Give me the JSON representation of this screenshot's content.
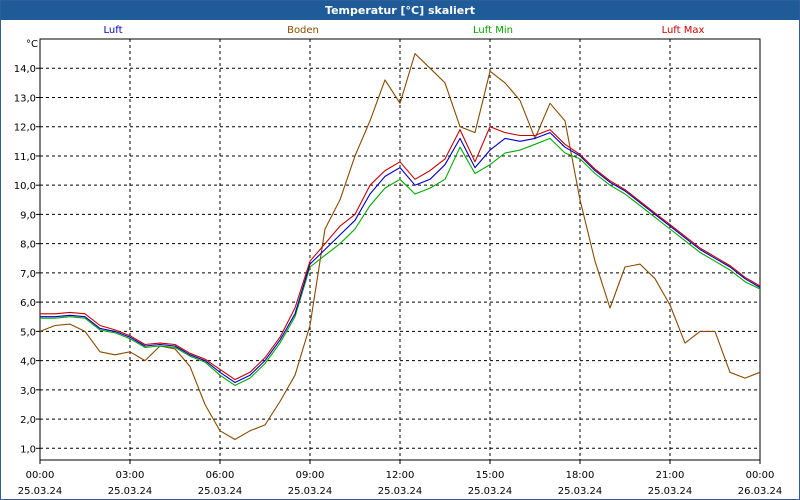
{
  "chart_data": {
    "type": "line",
    "title": "Temperatur [°C] skaliert",
    "ylabel": "°C",
    "ylim": [
      0.6,
      15.0
    ],
    "y_ticks": [
      "1,0",
      "2,0",
      "3,0",
      "4,0",
      "5,0",
      "6,0",
      "7,0",
      "8,0",
      "9,0",
      "10,0",
      "11,0",
      "12,0",
      "13,0",
      "14,0"
    ],
    "x_ticks": [
      {
        "time": "00:00",
        "date": "25.03.24"
      },
      {
        "time": "03:00",
        "date": "25.03.24"
      },
      {
        "time": "06:00",
        "date": "25.03.24"
      },
      {
        "time": "09:00",
        "date": "25.03.24"
      },
      {
        "time": "12:00",
        "date": "25.03.24"
      },
      {
        "time": "15:00",
        "date": "25.03.24"
      },
      {
        "time": "18:00",
        "date": "25.03.24"
      },
      {
        "time": "21:00",
        "date": "25.03.24"
      },
      {
        "time": "00:00",
        "date": "26.03.24"
      }
    ],
    "grid": true,
    "series": [
      {
        "name": "Luft",
        "color": "#0000c8",
        "x": [
          0,
          0.5,
          1,
          1.5,
          2,
          2.5,
          3,
          3.5,
          4,
          4.5,
          5,
          5.5,
          6,
          6.5,
          7,
          7.5,
          8,
          8.5,
          9,
          9.5,
          10,
          10.5,
          11,
          11.5,
          12,
          12.5,
          13,
          13.5,
          14,
          14.5,
          15,
          15.5,
          16,
          16.5,
          17,
          17.5,
          18,
          18.5,
          19,
          19.5,
          20,
          20.5,
          21,
          21.5,
          22,
          22.5,
          23,
          23.5,
          24
        ],
        "y": [
          5.5,
          5.5,
          5.55,
          5.5,
          5.1,
          5.0,
          4.8,
          4.5,
          4.55,
          4.5,
          4.2,
          4.0,
          3.6,
          3.25,
          3.5,
          4.0,
          4.7,
          5.6,
          7.3,
          7.8,
          8.3,
          8.8,
          9.7,
          10.3,
          10.6,
          10.0,
          10.2,
          10.7,
          11.6,
          10.6,
          11.2,
          11.6,
          11.5,
          11.6,
          11.8,
          11.3,
          11.0,
          10.5,
          10.1,
          9.8,
          9.4,
          9.0,
          8.6,
          8.2,
          7.8,
          7.5,
          7.2,
          6.8,
          6.5
        ]
      },
      {
        "name": "Boden",
        "color": "#8b4a00",
        "x": [
          0,
          0.5,
          1,
          1.5,
          2,
          2.5,
          3,
          3.5,
          4,
          4.5,
          5,
          5.5,
          6,
          6.5,
          7,
          7.5,
          8,
          8.5,
          9,
          9.5,
          10,
          10.5,
          11,
          11.5,
          12,
          12.5,
          13,
          13.5,
          14,
          14.5,
          15,
          15.5,
          16,
          16.5,
          17,
          17.5,
          18,
          18.5,
          19,
          19.5,
          20,
          20.5,
          21,
          21.5,
          22,
          22.5,
          23,
          23.5,
          24
        ],
        "y": [
          5.0,
          5.2,
          5.25,
          5.0,
          4.3,
          4.2,
          4.3,
          4.0,
          4.5,
          4.4,
          3.8,
          2.5,
          1.6,
          1.3,
          1.6,
          1.8,
          2.6,
          3.5,
          5.2,
          8.5,
          9.5,
          11.0,
          12.2,
          13.6,
          12.8,
          14.5,
          14.0,
          13.5,
          12.0,
          11.8,
          13.9,
          13.5,
          12.9,
          11.6,
          12.8,
          12.2,
          9.5,
          7.4,
          5.8,
          7.2,
          7.3,
          6.8,
          5.9,
          4.6,
          5.0,
          5.0,
          3.6,
          3.4,
          3.6
        ]
      },
      {
        "name": "Luft Min",
        "color": "#00aa00",
        "x": [
          0,
          0.5,
          1,
          1.5,
          2,
          2.5,
          3,
          3.5,
          4,
          4.5,
          5,
          5.5,
          6,
          6.5,
          7,
          7.5,
          8,
          8.5,
          9,
          9.5,
          10,
          10.5,
          11,
          11.5,
          12,
          12.5,
          13,
          13.5,
          14,
          14.5,
          15,
          15.5,
          16,
          16.5,
          17,
          17.5,
          18,
          18.5,
          19,
          19.5,
          20,
          20.5,
          21,
          21.5,
          22,
          22.5,
          23,
          23.5,
          24
        ],
        "y": [
          5.45,
          5.45,
          5.5,
          5.45,
          5.05,
          4.95,
          4.75,
          4.45,
          4.5,
          4.45,
          4.15,
          3.95,
          3.5,
          3.15,
          3.4,
          3.9,
          4.6,
          5.5,
          7.2,
          7.6,
          8.0,
          8.5,
          9.3,
          9.9,
          10.2,
          9.7,
          9.9,
          10.2,
          11.3,
          10.4,
          10.7,
          11.1,
          11.2,
          11.4,
          11.6,
          11.1,
          10.9,
          10.4,
          10.0,
          9.7,
          9.3,
          8.9,
          8.5,
          8.1,
          7.7,
          7.4,
          7.1,
          6.7,
          6.45
        ]
      },
      {
        "name": "Luft Max",
        "color": "#c80000",
        "x": [
          0,
          0.5,
          1,
          1.5,
          2,
          2.5,
          3,
          3.5,
          4,
          4.5,
          5,
          5.5,
          6,
          6.5,
          7,
          7.5,
          8,
          8.5,
          9,
          9.5,
          10,
          10.5,
          11,
          11.5,
          12,
          12.5,
          13,
          13.5,
          14,
          14.5,
          15,
          15.5,
          16,
          16.5,
          17,
          17.5,
          18,
          18.5,
          19,
          19.5,
          20,
          20.5,
          21,
          21.5,
          22,
          22.5,
          23,
          23.5,
          24
        ],
        "y": [
          5.6,
          5.6,
          5.65,
          5.6,
          5.2,
          5.05,
          4.85,
          4.55,
          4.6,
          4.55,
          4.25,
          4.05,
          3.7,
          3.35,
          3.6,
          4.1,
          4.8,
          5.8,
          7.4,
          8.0,
          8.6,
          9.0,
          10.0,
          10.5,
          10.8,
          10.2,
          10.5,
          10.9,
          11.9,
          10.8,
          12.0,
          11.8,
          11.7,
          11.7,
          11.9,
          11.4,
          11.05,
          10.55,
          10.15,
          9.85,
          9.45,
          9.05,
          8.65,
          8.25,
          7.85,
          7.55,
          7.25,
          6.85,
          6.55
        ]
      }
    ]
  }
}
